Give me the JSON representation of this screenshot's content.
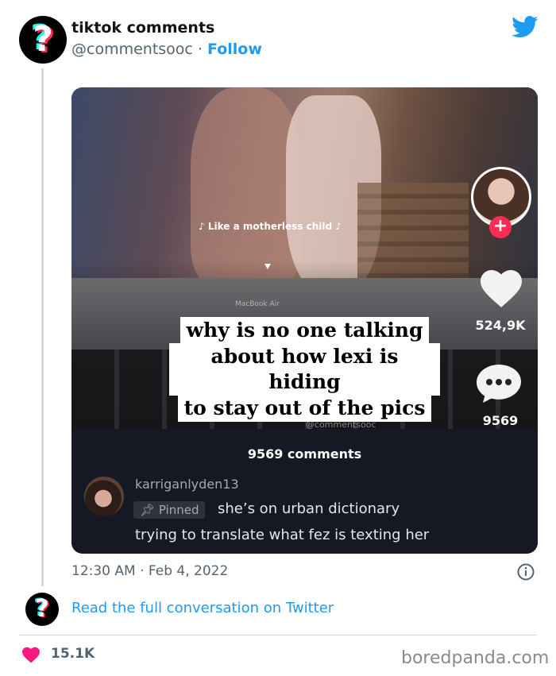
{
  "author": {
    "name": "tiktok comments",
    "handle": "@commentsooc",
    "separator": " · ",
    "follow_label": "Follow"
  },
  "video": {
    "song_caption": "♪ Like a motherless child ♪",
    "laptop_label": "MacBook Air",
    "caption_lines": [
      "why is no one talking",
      "about how lexi is hiding",
      "to stay out of the pics"
    ],
    "like_count": "524,9K",
    "comment_count": "9569",
    "watermark": "@commentsooc"
  },
  "comments": {
    "title": "9569 comments",
    "pinned_comment": {
      "username": "karriganlyden13",
      "badge": "Pinned",
      "text_line1": "she’s on urban dictionary",
      "text_line2": "trying to translate what fez is texting her"
    }
  },
  "tweet": {
    "timestamp": "12:30 AM · Feb 4, 2022",
    "read_link": "Read the full conversation on Twitter",
    "like_total": "15.1K"
  },
  "footer": {
    "brand": "boredpanda.com"
  },
  "colors": {
    "twitter_blue": "#1d9bf0",
    "tiktok_red": "#fe2c55",
    "tiktok_cyan": "#25f4ee",
    "heart_red": "#f91880"
  }
}
